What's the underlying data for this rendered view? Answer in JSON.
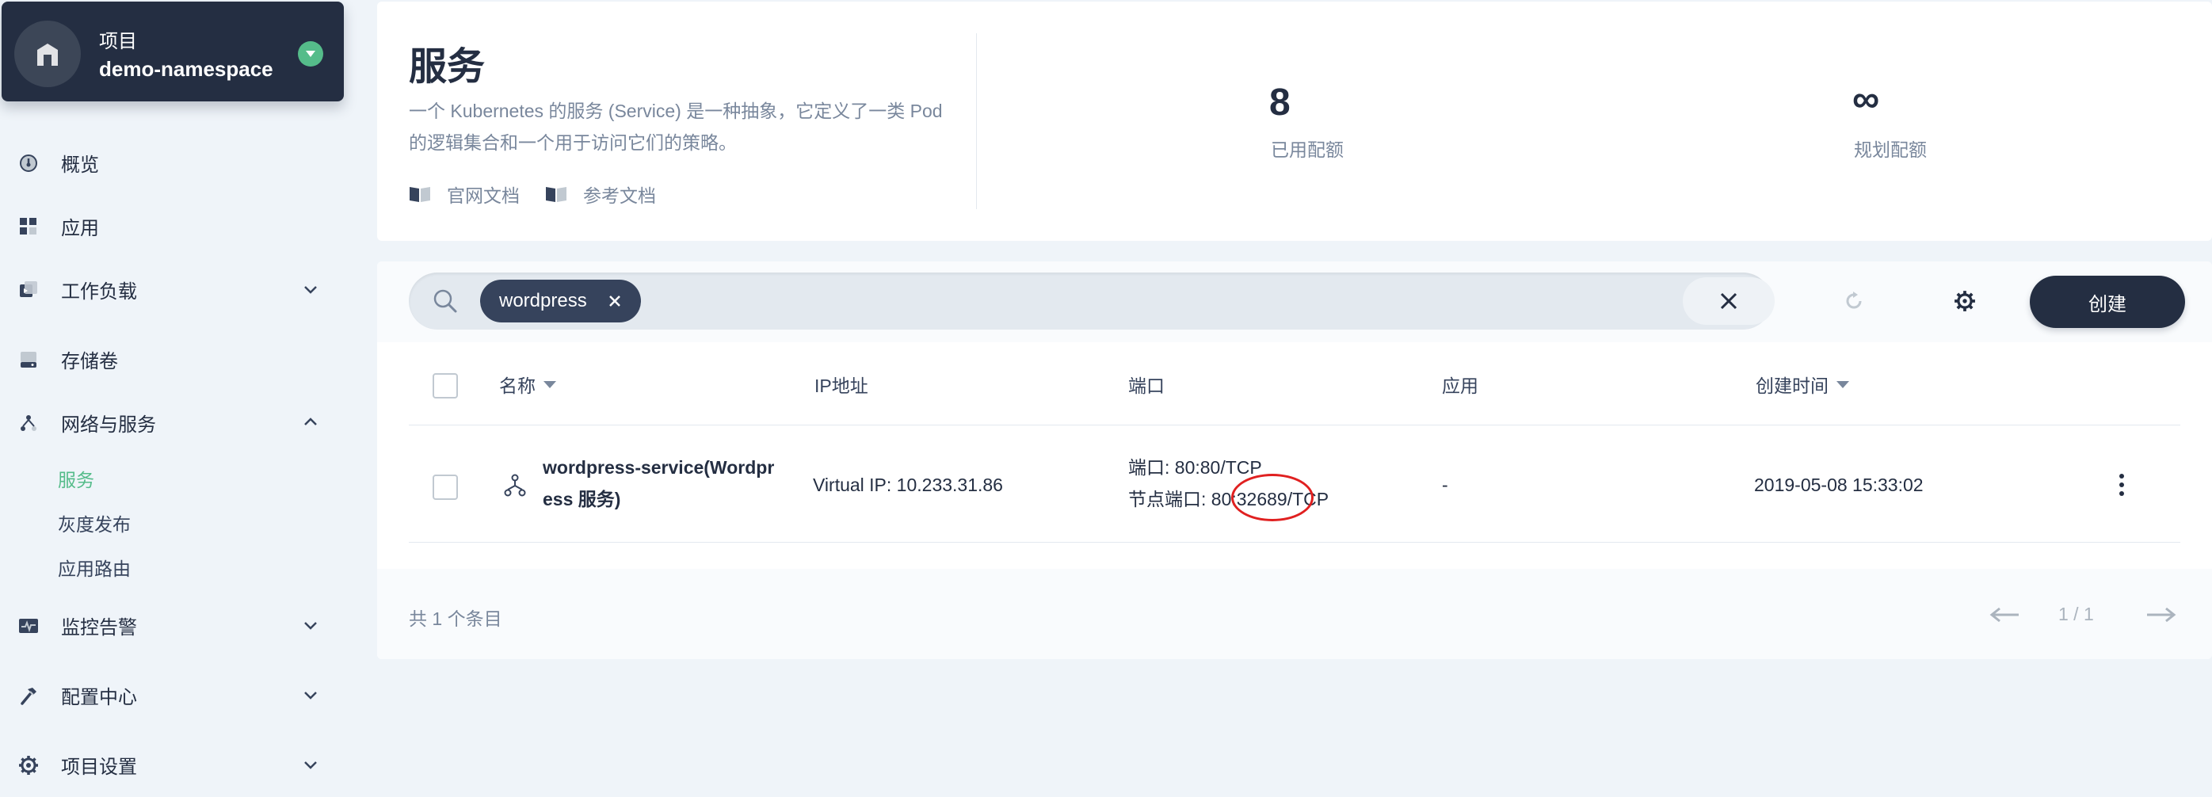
{
  "project": {
    "type_label": "项目",
    "name": "demo-namespace"
  },
  "sidebar": {
    "items": [
      {
        "label": "概览",
        "icon": "dashboard-icon"
      },
      {
        "label": "应用",
        "icon": "apps-icon"
      },
      {
        "label": "工作负载",
        "icon": "workload-icon",
        "expandable": true
      },
      {
        "label": "存储卷",
        "icon": "storage-icon"
      },
      {
        "label": "网络与服务",
        "icon": "network-icon",
        "expandable": true,
        "expanded": true
      },
      {
        "label": "监控告警",
        "icon": "monitor-icon",
        "expandable": true
      },
      {
        "label": "配置中心",
        "icon": "hammer-icon",
        "expandable": true
      },
      {
        "label": "项目设置",
        "icon": "gear-icon",
        "expandable": true
      }
    ],
    "network_sub_items": [
      {
        "label": "服务",
        "active": true
      },
      {
        "label": "灰度发布",
        "active": false
      },
      {
        "label": "应用路由",
        "active": false
      }
    ]
  },
  "header": {
    "title": "服务",
    "description": "一个 Kubernetes 的服务 (Service) 是一种抽象，它定义了一类 Pod 的逻辑集合和一个用于访问它们的策略。",
    "links": [
      "官网文档",
      "参考文档"
    ],
    "quota_used_value": "8",
    "quota_used_label": "已用配额",
    "quota_planned_value": "∞",
    "quota_planned_label": "规划配额"
  },
  "toolbar": {
    "filter_tag": "wordpress",
    "create_label": "创建"
  },
  "table": {
    "columns": {
      "name": "名称",
      "ip": "IP地址",
      "port": "端口",
      "app": "应用",
      "created": "创建时间"
    },
    "rows": [
      {
        "name_line1": "wordpress-service(Wordpr",
        "name_line2": "ess 服务)",
        "ip": "Virtual IP: 10.233.31.86",
        "port_line1": "端口: 80:80/TCP",
        "port_line2": "节点端口: 80:32689/TCP",
        "app": "-",
        "created": "2019-05-08 15:33:02"
      }
    ]
  },
  "footer": {
    "total": "共 1 个条目",
    "page": "1 / 1"
  },
  "colors": {
    "primary_dark": "#242e42",
    "accent_green": "#55bc8a",
    "highlight_red": "#e02020",
    "muted_text": "#79879c"
  }
}
